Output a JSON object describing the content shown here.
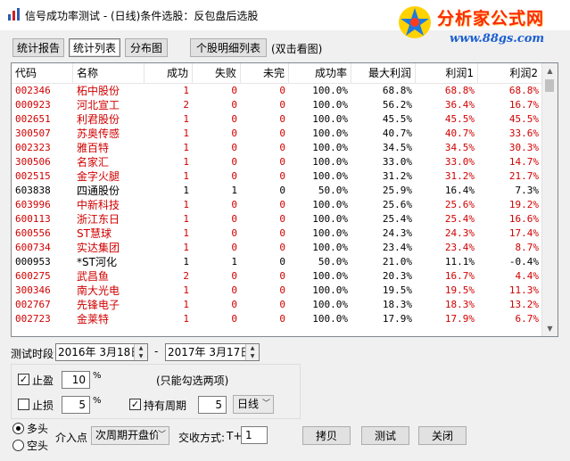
{
  "window": {
    "title": "信号成功率测试 - (日线)条件选股：反包盘后选股",
    "logo_main": "分析家公式网",
    "logo_url": "www.88gs.com"
  },
  "tabs": [
    "统计报告",
    "统计列表",
    "分布图"
  ],
  "detail_button": "个股明细列表",
  "detail_hint": "(双击看图)",
  "table": {
    "headers": [
      "代码",
      "名称",
      "成功",
      "失败",
      "未完",
      "成功率",
      "最大利润",
      "利润1",
      "利润2"
    ],
    "rows": [
      {
        "code": "002346",
        "name": "柘中股份",
        "succ": "1",
        "fail": "0",
        "open": "0",
        "rate": "100.0%",
        "max": "68.8%",
        "p1": "68.8%",
        "p2": "68.8%",
        "color": "red"
      },
      {
        "code": "000923",
        "name": "河北宣工",
        "succ": "2",
        "fail": "0",
        "open": "0",
        "rate": "100.0%",
        "max": "56.2%",
        "p1": "36.4%",
        "p2": "16.7%",
        "color": "red"
      },
      {
        "code": "002651",
        "name": "利君股份",
        "succ": "1",
        "fail": "0",
        "open": "0",
        "rate": "100.0%",
        "max": "45.5%",
        "p1": "45.5%",
        "p2": "45.5%",
        "color": "red"
      },
      {
        "code": "300507",
        "name": "苏奥传感",
        "succ": "1",
        "fail": "0",
        "open": "0",
        "rate": "100.0%",
        "max": "40.7%",
        "p1": "40.7%",
        "p2": "33.6%",
        "color": "red"
      },
      {
        "code": "002323",
        "name": "雅百特",
        "succ": "1",
        "fail": "0",
        "open": "0",
        "rate": "100.0%",
        "max": "34.5%",
        "p1": "34.5%",
        "p2": "30.3%",
        "color": "red"
      },
      {
        "code": "300506",
        "name": "名家汇",
        "succ": "1",
        "fail": "0",
        "open": "0",
        "rate": "100.0%",
        "max": "33.0%",
        "p1": "33.0%",
        "p2": "14.7%",
        "color": "red"
      },
      {
        "code": "002515",
        "name": "金字火腿",
        "succ": "1",
        "fail": "0",
        "open": "0",
        "rate": "100.0%",
        "max": "31.2%",
        "p1": "31.2%",
        "p2": "21.7%",
        "color": "red"
      },
      {
        "code": "603838",
        "name": "四通股份",
        "succ": "1",
        "fail": "1",
        "open": "0",
        "rate": "50.0%",
        "max": "25.9%",
        "p1": "16.4%",
        "p2": "7.3%",
        "color": "black"
      },
      {
        "code": "603996",
        "name": "中新科技",
        "succ": "1",
        "fail": "0",
        "open": "0",
        "rate": "100.0%",
        "max": "25.6%",
        "p1": "25.6%",
        "p2": "19.2%",
        "color": "red"
      },
      {
        "code": "600113",
        "name": "浙江东日",
        "succ": "1",
        "fail": "0",
        "open": "0",
        "rate": "100.0%",
        "max": "25.4%",
        "p1": "25.4%",
        "p2": "16.6%",
        "color": "red"
      },
      {
        "code": "600556",
        "name": "ST慧球",
        "succ": "1",
        "fail": "0",
        "open": "0",
        "rate": "100.0%",
        "max": "24.3%",
        "p1": "24.3%",
        "p2": "17.4%",
        "color": "red"
      },
      {
        "code": "600734",
        "name": "实达集团",
        "succ": "1",
        "fail": "0",
        "open": "0",
        "rate": "100.0%",
        "max": "23.4%",
        "p1": "23.4%",
        "p2": "8.7%",
        "color": "red"
      },
      {
        "code": "000953",
        "name": "*ST河化",
        "succ": "1",
        "fail": "1",
        "open": "0",
        "rate": "50.0%",
        "max": "21.0%",
        "p1": "11.1%",
        "p2": "-0.4%",
        "color": "black"
      },
      {
        "code": "600275",
        "name": "武昌鱼",
        "succ": "2",
        "fail": "0",
        "open": "0",
        "rate": "100.0%",
        "max": "20.3%",
        "p1": "16.7%",
        "p2": "4.4%",
        "color": "red"
      },
      {
        "code": "300346",
        "name": "南大光电",
        "succ": "1",
        "fail": "0",
        "open": "0",
        "rate": "100.0%",
        "max": "19.5%",
        "p1": "19.5%",
        "p2": "11.3%",
        "color": "red"
      },
      {
        "code": "002767",
        "name": "先锋电子",
        "succ": "1",
        "fail": "0",
        "open": "0",
        "rate": "100.0%",
        "max": "18.3%",
        "p1": "18.3%",
        "p2": "13.2%",
        "color": "red"
      },
      {
        "code": "002723",
        "name": "金莱特",
        "succ": "1",
        "fail": "0",
        "open": "0",
        "rate": "100.0%",
        "max": "17.9%",
        "p1": "17.9%",
        "p2": "6.7%",
        "color": "red"
      }
    ]
  },
  "period": {
    "label": "测试时段",
    "start": "2016年 3月18日",
    "dash": "-",
    "end": "2017年 3月17日"
  },
  "take_profit": {
    "label": "止盈",
    "value": "10",
    "unit": "%",
    "checked": true
  },
  "note": "(只能勾选两项)",
  "stop_loss": {
    "label": "止损",
    "value": "5",
    "unit": "%",
    "checked": false
  },
  "hold_period": {
    "label": "持有周期",
    "value": "5",
    "checked": true,
    "unit_select": "日线"
  },
  "direction": {
    "long": "多头",
    "short": "空头",
    "selected": "long"
  },
  "entry": {
    "label": "介入点",
    "value": "次周期开盘价"
  },
  "settle": {
    "label": "交收方式:",
    "prefix": "T+",
    "value": "1"
  },
  "buttons": {
    "copy": "拷贝",
    "test": "测试",
    "close": "关闭"
  },
  "colors": {
    "positive": "#d10000",
    "neutral": "#000000",
    "accent_logo": "#ff2a00",
    "logo_url": "#1a5fd0"
  }
}
